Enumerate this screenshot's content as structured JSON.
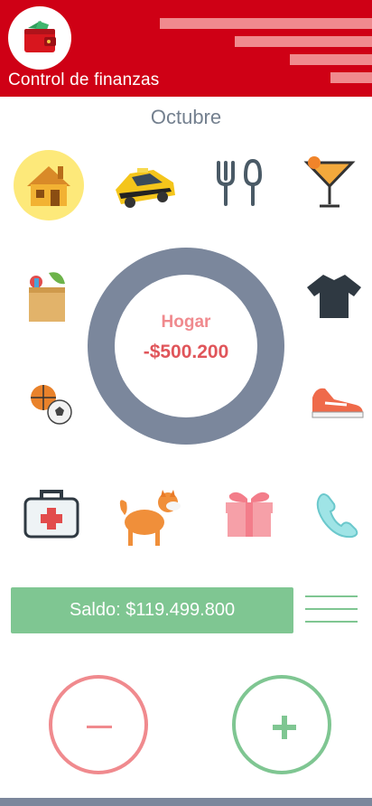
{
  "header": {
    "title": "Control de finanzas",
    "logo_icon": "wallet-icon",
    "background_color": "#cf0015"
  },
  "month": "Octubre",
  "categories": [
    {
      "name": "Hogar",
      "icon": "house-icon",
      "selected": true
    },
    {
      "name": "taxi",
      "icon": "taxi-icon"
    },
    {
      "name": "comida",
      "icon": "fork-spoon-icon"
    },
    {
      "name": "bebidas",
      "icon": "cocktail-icon"
    },
    {
      "name": "mercado",
      "icon": "grocery-bag-icon"
    },
    {
      "name": "ropa",
      "icon": "tshirt-icon"
    },
    {
      "name": "deportes",
      "icon": "balls-icon"
    },
    {
      "name": "calzado",
      "icon": "sneaker-icon"
    },
    {
      "name": "salud",
      "icon": "first-aid-kit-icon"
    },
    {
      "name": "mascotas",
      "icon": "dog-icon"
    },
    {
      "name": "regalos",
      "icon": "gift-icon"
    },
    {
      "name": "telefono",
      "icon": "phone-icon"
    }
  ],
  "summary": {
    "category": "Hogar",
    "amount": "-$500.200",
    "ring_color": "#7b879c"
  },
  "balance": {
    "label": "Saldo: $119.499.800",
    "color": "#7fc692"
  },
  "actions": {
    "minus_icon": "minus-icon",
    "plus_icon": "plus-icon",
    "minus_color": "#f08a8e",
    "plus_color": "#7fc692"
  }
}
